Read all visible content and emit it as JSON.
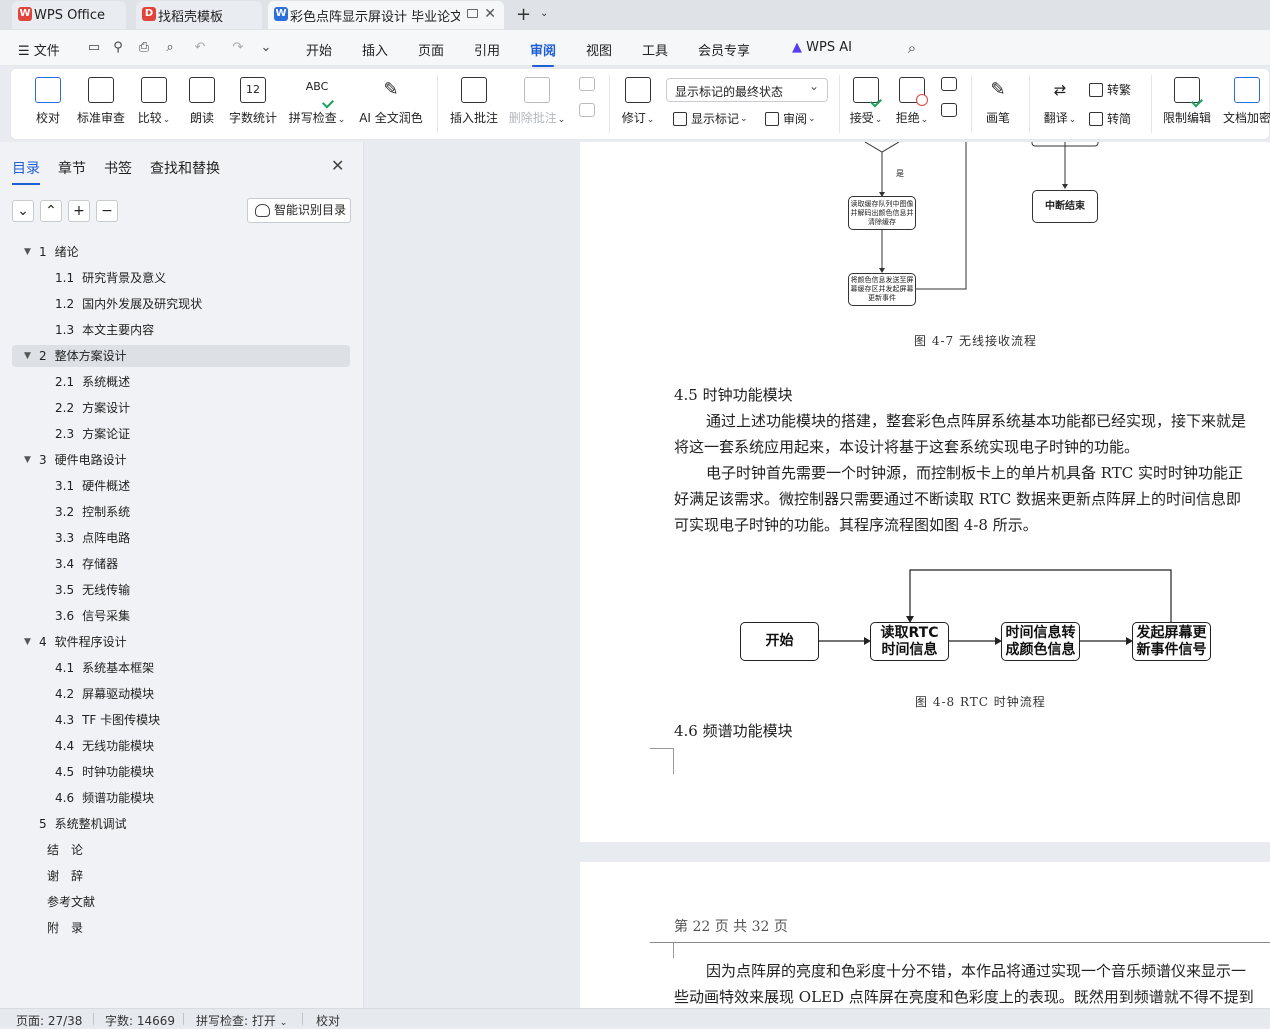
{
  "tabs": [
    {
      "label": "WPS Office"
    },
    {
      "label": "找稻壳模板"
    },
    {
      "label": "彩色点阵显示屏设计 毕业论文"
    }
  ],
  "menu": {
    "file": "文件",
    "items": [
      "开始",
      "插入",
      "页面",
      "引用",
      "审阅",
      "视图",
      "工具",
      "会员专享",
      "WPS AI"
    ]
  },
  "ribbon": {
    "proofread": "校对",
    "standard_review": "标准审查",
    "compare": "比较",
    "read_aloud": "朗读",
    "word_count": "字数统计",
    "spell_check": "拼写检查",
    "ai_polish": "AI 全文润色",
    "insert_comment": "插入批注",
    "delete_comment": "删除批注",
    "track": "修订",
    "markup_state": "显示标记的最终状态",
    "show_markup": "显示标记",
    "review_pane": "审阅",
    "accept": "接受",
    "reject": "拒绝",
    "pen": "画笔",
    "translate": "翻译",
    "to_trad": "转繁",
    "to_simp": "转简",
    "restrict": "限制编辑",
    "encrypt": "文档加密",
    "icon_word_count": "12",
    "icon_spell": "ABC"
  },
  "nav": {
    "tabs": [
      "目录",
      "章节",
      "书签",
      "查找和替换"
    ],
    "smart_toc": "智能识别目录"
  },
  "toc": [
    {
      "num": "1",
      "title": "绪论",
      "level": 1,
      "collapsible": true
    },
    {
      "num": "1.1",
      "title": "研究背景及意义",
      "level": 2
    },
    {
      "num": "1.2",
      "title": "国内外发展及研究现状",
      "level": 2
    },
    {
      "num": "1.3",
      "title": "本文主要内容",
      "level": 2
    },
    {
      "num": "2",
      "title": "整体方案设计",
      "level": 1,
      "collapsible": true,
      "selected": true
    },
    {
      "num": "2.1",
      "title": "系统概述",
      "level": 2
    },
    {
      "num": "2.2",
      "title": "方案设计",
      "level": 2
    },
    {
      "num": "2.3",
      "title": "方案论证",
      "level": 2
    },
    {
      "num": "3",
      "title": "硬件电路设计",
      "level": 1,
      "collapsible": true
    },
    {
      "num": "3.1",
      "title": "硬件概述",
      "level": 2
    },
    {
      "num": "3.2",
      "title": "控制系统",
      "level": 2
    },
    {
      "num": "3.3",
      "title": "点阵电路",
      "level": 2
    },
    {
      "num": "3.4",
      "title": "存储器",
      "level": 2
    },
    {
      "num": "3.5",
      "title": "无线传输",
      "level": 2
    },
    {
      "num": "3.6",
      "title": "信号采集",
      "level": 2
    },
    {
      "num": "4",
      "title": "软件程序设计",
      "level": 1,
      "collapsible": true
    },
    {
      "num": "4.1",
      "title": "系统基本框架",
      "level": 2
    },
    {
      "num": "4.2",
      "title": "屏幕驱动模块",
      "level": 2
    },
    {
      "num": "4.3",
      "title": "TF 卡图传模块",
      "level": 2
    },
    {
      "num": "4.4",
      "title": "无线功能模块",
      "level": 2
    },
    {
      "num": "4.5",
      "title": "时钟功能模块",
      "level": 2
    },
    {
      "num": "4.6",
      "title": "频谱功能模块",
      "level": 2
    },
    {
      "num": "5",
      "title": "系统整机调试",
      "level": 1
    },
    {
      "num": "",
      "title": "结　论",
      "level": 1
    },
    {
      "num": "",
      "title": "谢　辞",
      "level": 1
    },
    {
      "num": "",
      "title": "参考文献",
      "level": 1
    },
    {
      "num": "",
      "title": "附　录",
      "level": 1
    }
  ],
  "doc": {
    "fig47": {
      "yes": "是",
      "box1": "读取缓存队列中图像并解码出颜色信息并清除缓存",
      "box2": "将颜色信息发送至屏幕缓存区并发起屏幕更新事件",
      "end": "中断结束",
      "caption": "图 4-7  无线接收流程"
    },
    "sec45": {
      "heading": "4.5  时钟功能模块",
      "p1a": "通过上述功能模块的搭建，整套彩色点阵屏系统基本功能都已经实现，接下来就是",
      "p1b": "将这一套系统应用起来，本设计将基于这套系统实现电子时钟的功能。",
      "p2a": "电子时钟首先需要一个时钟源，而控制板卡上的单片机具备 RTC 实时时钟功能正",
      "p2b": "好满足该需求。微控制器只需要通过不断读取 RTC 数据来更新点阵屏上的时间信息即",
      "p2c": "可实现电子时钟的功能。其程序流程图如图 4-8 所示。"
    },
    "fig48": {
      "start": "开始",
      "read": "读取RTC\n时间信息",
      "convert": "时间信息转\n成颜色信息",
      "update": "发起屏幕更\n新事件信号",
      "caption": "图 4-8 RTC 时钟流程"
    },
    "sec46": {
      "heading": "4.6  频谱功能模块"
    },
    "page_header": "第  22  页    共  32  页",
    "p3a": "因为点阵屏的亮度和色彩度十分不错，本作品将通过实现一个音乐频谱仪来显示一",
    "p3b": "些动画特效来展现 OLED 点阵屏在亮度和色彩度上的表现。既然用到频谱就不得不提到"
  },
  "status": {
    "page": "页面: 27/38",
    "words": "字数: 14669",
    "spell": "拼写检查: 打开",
    "proof": "校对"
  },
  "colors": {
    "accent": "#1f5fd6",
    "wps_red": "#e0443a"
  }
}
